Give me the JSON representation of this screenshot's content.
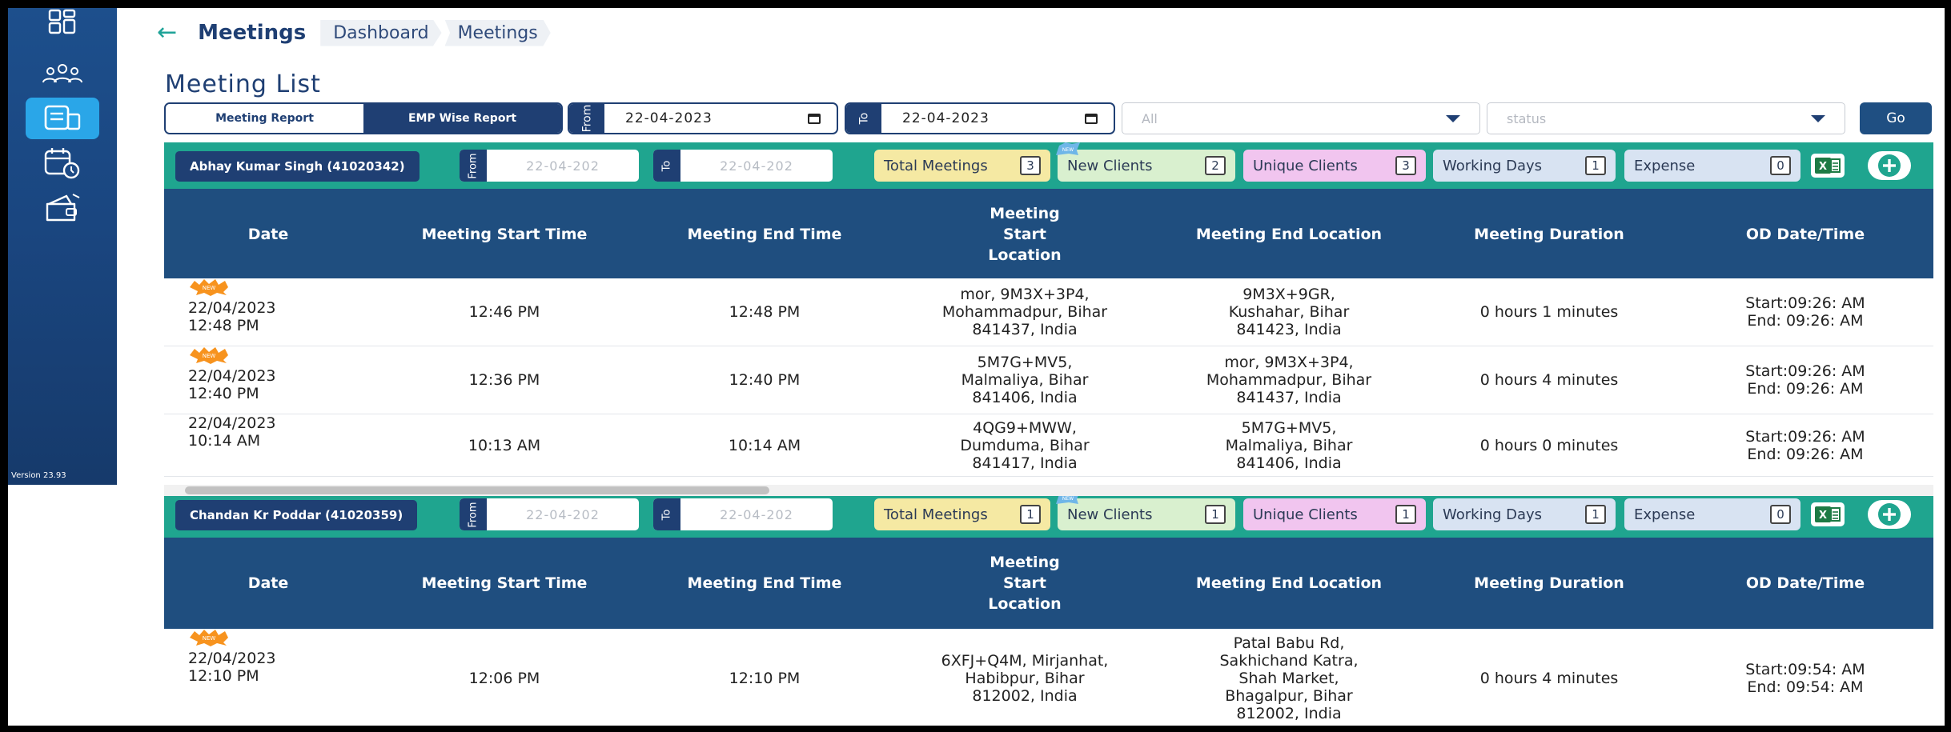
{
  "sidebar": {
    "icons": [
      "dashboard-icon",
      "team-icon",
      "report-icon",
      "calendar-clock-icon",
      "wallet-icon"
    ],
    "active_index": 2,
    "version": "Version 23.93"
  },
  "header": {
    "title": "Meetings",
    "breadcrumbs": [
      "Dashboard",
      "Meetings"
    ]
  },
  "page_title": "Meeting List",
  "filters": {
    "tabs": [
      "Meeting Report",
      "EMP Wise Report"
    ],
    "selected_tab": 1,
    "from_label": "From",
    "from_value": "22-04-2023",
    "to_label": "To",
    "to_value": "22-04-2023",
    "employee_select": "All",
    "status_select": "status",
    "go_label": "Go"
  },
  "columns": [
    "Date",
    "Meeting Start Time",
    "Meeting End Time",
    "Meeting Start Location",
    "Meeting End Location",
    "Meeting Duration",
    "OD Date/Time"
  ],
  "groups": [
    {
      "employee": "Abhay Kumar Singh (41020342)",
      "from_label": "From",
      "from_placeholder": "22-04-202",
      "to_label": "To",
      "to_placeholder": "22-04-202",
      "stats": {
        "total_meetings_label": "Total Meetings",
        "total_meetings": "3",
        "new_clients_label": "New Clients",
        "new_clients": "2",
        "unique_clients_label": "Unique Clients",
        "unique_clients": "3",
        "working_days_label": "Working Days",
        "working_days": "1",
        "expense_label": "Expense",
        "expense": "0"
      },
      "rows": [
        {
          "is_new": true,
          "date": "22/04/2023",
          "time": "12:48 PM",
          "start_time": "12:46 PM",
          "end_time": "12:48 PM",
          "start_location": [
            "mor, 9M3X+3P4,",
            "Mohammadpur, Bihar",
            "841437, India"
          ],
          "end_location": [
            "9M3X+9GR,",
            "Kushahar, Bihar",
            "841423, India"
          ],
          "duration": "0 hours 1 minutes",
          "od_start": "Start:09:26: AM",
          "od_end": "End: 09:26: AM",
          "clipped": "L"
        },
        {
          "is_new": true,
          "date": "22/04/2023",
          "time": "12:40 PM",
          "start_time": "12:36 PM",
          "end_time": "12:40 PM",
          "start_location": [
            "5M7G+MV5,",
            "Malmaliya, Bihar",
            "841406, India"
          ],
          "end_location": [
            "mor, 9M3X+3P4,",
            "Mohammadpur, Bihar",
            "841437, India"
          ],
          "duration": "0 hours 4 minutes",
          "od_start": "Start:09:26: AM",
          "od_end": "End: 09:26: AM",
          "clipped": ""
        },
        {
          "is_new": false,
          "date": "22/04/2023",
          "time": "10:14 AM",
          "start_time": "10:13 AM",
          "end_time": "10:14 AM",
          "start_location": [
            "4QG9+MWW,",
            "Dumduma, Bihar",
            "841417, India"
          ],
          "end_location": [
            "5M7G+MV5,",
            "Malmaliya, Bihar",
            "841406, India"
          ],
          "duration": "0 hours 0 minutes",
          "od_start": "Start:09:26: AM",
          "od_end": "End: 09:26: AM",
          "clipped": "S"
        }
      ]
    },
    {
      "employee": "Chandan Kr Poddar (41020359)",
      "from_label": "From",
      "from_placeholder": "22-04-202",
      "to_label": "To",
      "to_placeholder": "22-04-202",
      "stats": {
        "total_meetings_label": "Total Meetings",
        "total_meetings": "1",
        "new_clients_label": "New Clients",
        "new_clients": "1",
        "unique_clients_label": "Unique Clients",
        "unique_clients": "1",
        "working_days_label": "Working Days",
        "working_days": "1",
        "expense_label": "Expense",
        "expense": "0"
      },
      "rows": [
        {
          "is_new": true,
          "date": "22/04/2023",
          "time": "12:10 PM",
          "start_time": "12:06 PM",
          "end_time": "12:10 PM",
          "start_location": [
            "6XFJ+Q4M, Mirjanhat,",
            "Habibpur, Bihar",
            "812002, India"
          ],
          "end_location": [
            "Patal Babu Rd,",
            "Sakhichand Katra,",
            "Shah Market,",
            "Bhagalpur, Bihar",
            "812002, India"
          ],
          "duration": "0 hours 4 minutes",
          "od_start": "Start:09:54: AM",
          "od_end": "End: 09:54: AM",
          "clipped": ""
        }
      ]
    }
  ],
  "colors": {
    "navy": "#1f3f73",
    "teal": "#1fa58f",
    "header_blue": "#1f4e7f",
    "accent_blue": "#2aa6e8"
  }
}
